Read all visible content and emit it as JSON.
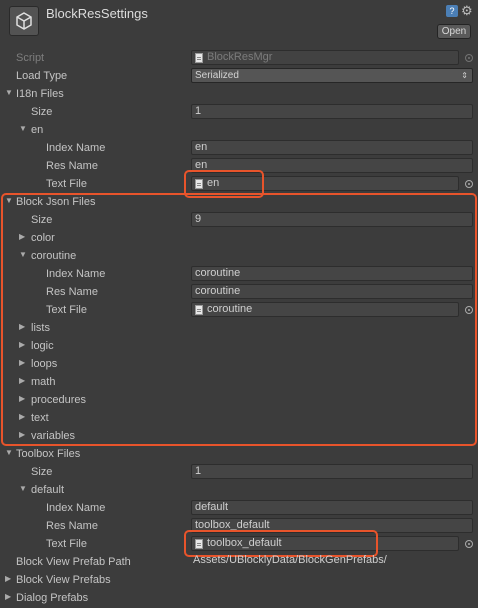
{
  "header": {
    "title": "BlockResSettings",
    "open_label": "Open",
    "icons": [
      "unity-logo-icon",
      "help-icon",
      "gear-icon"
    ]
  },
  "rows": {
    "script_label": "Script",
    "script_value": "BlockResMgr",
    "load_type_label": "Load Type",
    "load_type_value": "Serialized",
    "i18n_label": "I18n Files",
    "i18n_size_label": "Size",
    "i18n_size_value": "1",
    "en_label": "en",
    "en_index_label": "Index Name",
    "en_index_value": "en",
    "en_res_label": "Res Name",
    "en_res_value": "en",
    "en_text_label": "Text File",
    "en_text_value": "en",
    "json_label": "Block Json Files",
    "json_size_label": "Size",
    "json_size_value": "9",
    "color_label": "color",
    "coroutine_label": "coroutine",
    "co_index_label": "Index Name",
    "co_index_value": "coroutine",
    "co_res_label": "Res Name",
    "co_res_value": "coroutine",
    "co_text_label": "Text File",
    "co_text_value": "coroutine",
    "lists_label": "lists",
    "logic_label": "logic",
    "loops_label": "loops",
    "math_label": "math",
    "procedures_label": "procedures",
    "text_label": "text",
    "variables_label": "variables",
    "toolbox_label": "Toolbox Files",
    "tb_size_label": "Size",
    "tb_size_value": "1",
    "default_label": "default",
    "tb_index_label": "Index Name",
    "tb_index_value": "default",
    "tb_res_label": "Res Name",
    "tb_res_value": "toolbox_default",
    "tb_text_label": "Text File",
    "tb_text_value": "toolbox_default",
    "prefab_path_label": "Block View Prefab Path",
    "prefab_path_value": "Assets/UBlocklyData/BlockGenPrefabs/",
    "view_prefabs_label": "Block View Prefabs",
    "dialog_prefabs_label": "Dialog Prefabs"
  },
  "colors": {
    "highlight": "#e8542b",
    "background": "#3c3c3c"
  }
}
